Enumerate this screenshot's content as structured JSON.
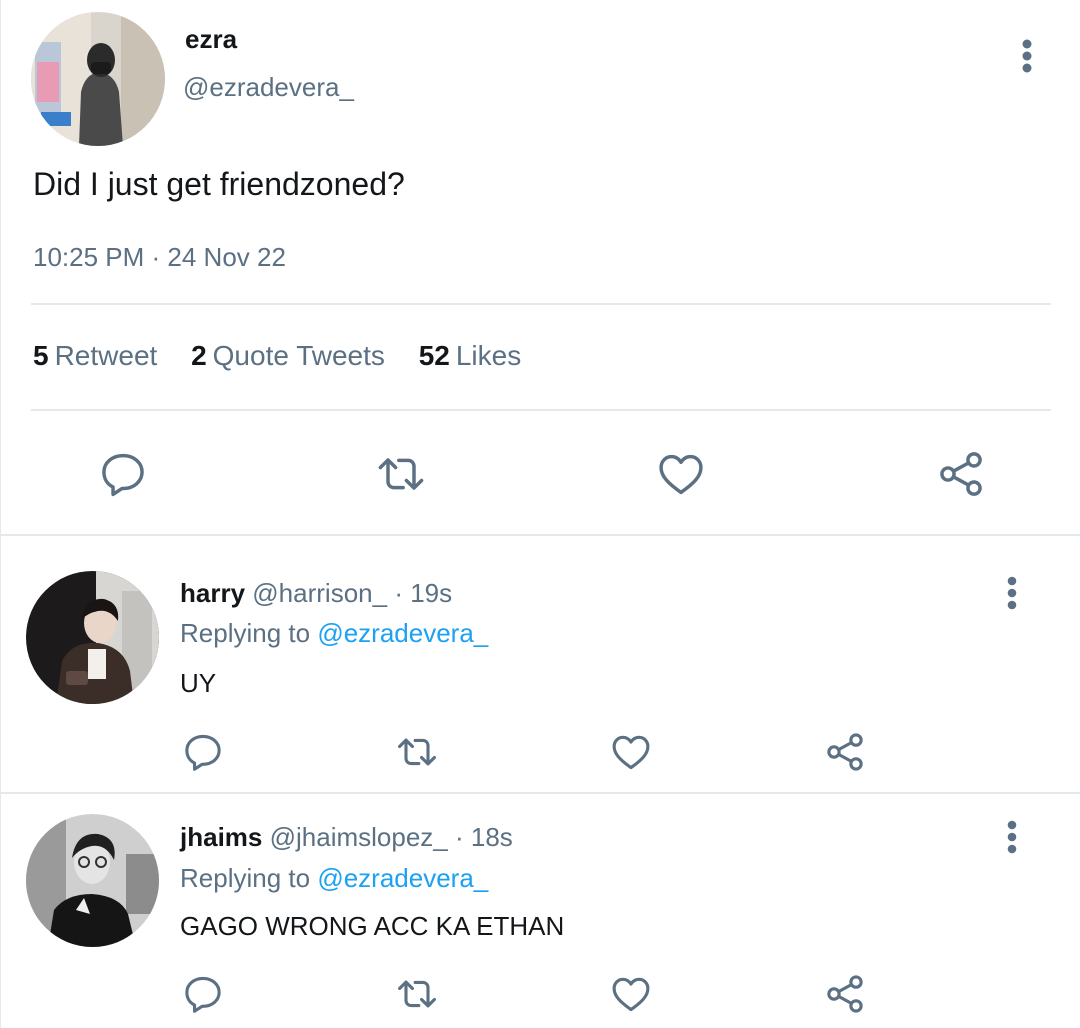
{
  "main_tweet": {
    "name": "ezra",
    "handle": "@ezradevera_",
    "text": "Did I just get friendzoned?",
    "timestamp": "10:25 PM · 24 Nov 22",
    "stats": [
      {
        "count": "5",
        "label": "Retweet"
      },
      {
        "count": "2",
        "label": "Quote Tweets"
      },
      {
        "count": "52",
        "label": "Likes"
      }
    ],
    "actions": [
      "reply-icon",
      "retweet-icon",
      "heart-icon",
      "share-icon"
    ]
  },
  "replies": [
    {
      "name": "harry",
      "handle": "@harrison_",
      "time": "· 19s",
      "replying_prefix": "Replying to",
      "replying_to": "@ezradevera_",
      "text": "UY"
    },
    {
      "name": "jhaims",
      "handle": "@jhaimslopez_",
      "time": "· 18s",
      "replying_prefix": "Replying to",
      "replying_to": "@ezradevera_",
      "text": "GAGO WRONG ACC KA ETHAN"
    }
  ],
  "colors": {
    "text_primary": "#14171a",
    "text_secondary": "#5b7083",
    "link": "#1da1f2",
    "divider": "#e6e9ec"
  }
}
